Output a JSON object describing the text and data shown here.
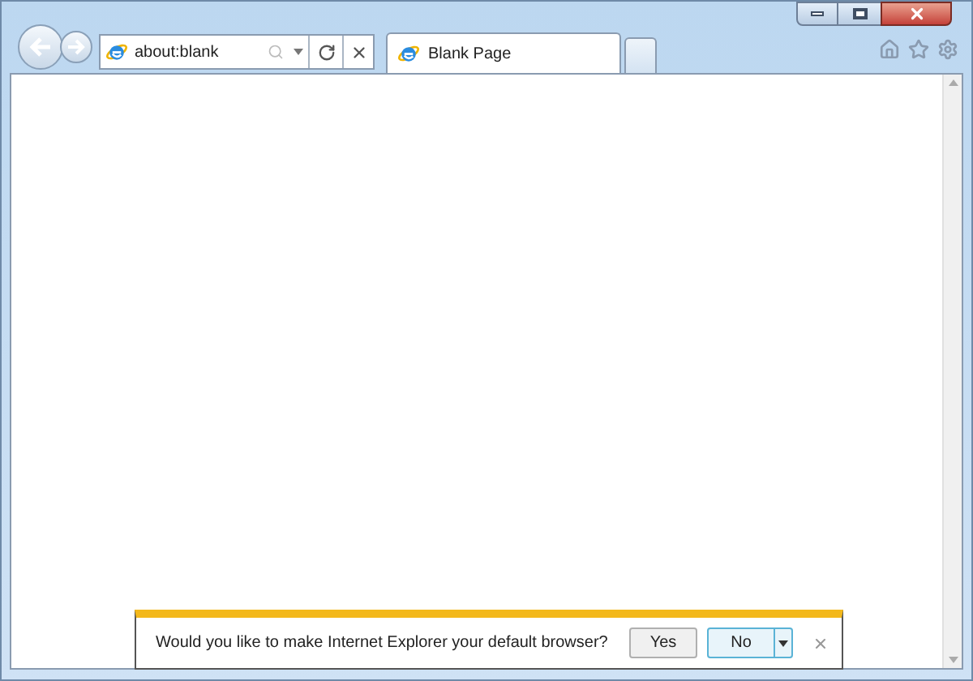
{
  "address_bar": {
    "value": "about:blank"
  },
  "tabs": [
    {
      "label": "Blank Page",
      "selected": true
    }
  ],
  "notification": {
    "message": "Would you like to make Internet Explorer your default browser?",
    "buttons": [
      {
        "label": "Yes",
        "selected": false
      },
      {
        "label": "No",
        "selected": true
      }
    ]
  }
}
